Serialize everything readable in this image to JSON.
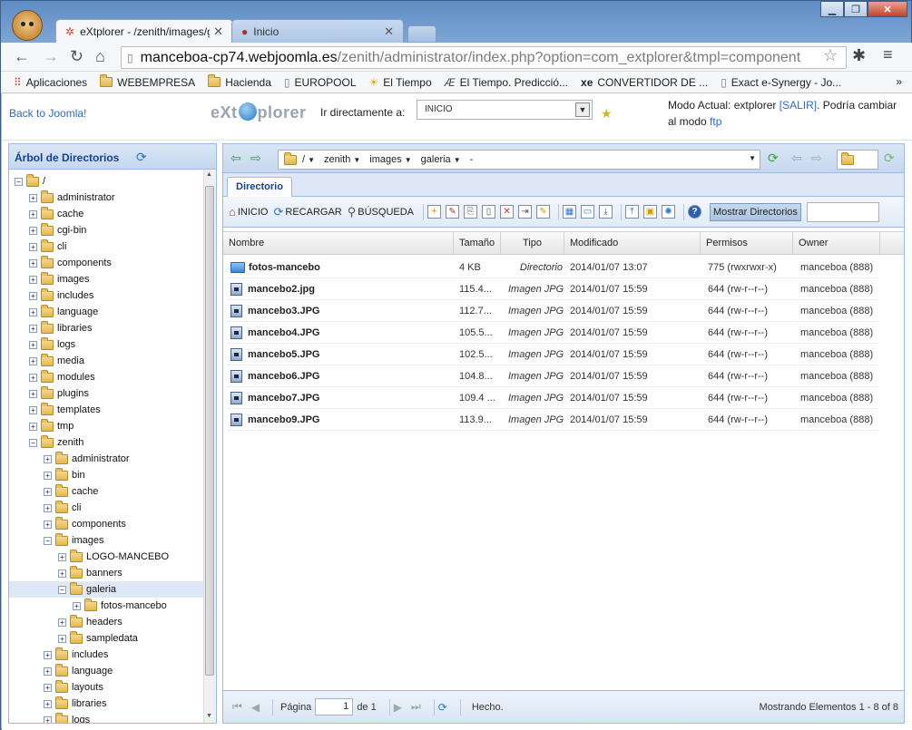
{
  "browser": {
    "tabs": [
      {
        "title": "eXtplorer - /zenith/images/galeria",
        "icon": "joomla-icon"
      },
      {
        "title": "Inicio",
        "icon": "drop-icon"
      }
    ],
    "url_domain": "manceboa-cp74.webjoomla.es",
    "url_path": "/zenith/administrator/index.php?option=com_extplorer&tmpl=component",
    "bookmarks": [
      "Aplicaciones",
      "WEBEMPRESA",
      "Hacienda",
      "EUROPOOL",
      "El Tiempo",
      "El Tiempo. Predicció...",
      "CONVERTIDOR DE ...",
      "Exact e-Synergy - Jo..."
    ]
  },
  "header": {
    "back_link": "Back to Joomla!",
    "logo_a": "eXt",
    "logo_b": "plorer",
    "goto_label": "Ir directamente a:",
    "goto_value": "INICIO",
    "mode_prefix": "Modo Actual: extplorer ",
    "mode_exit": "[SALIR]",
    "mode_mid": ". Podría cambiar al modo ",
    "mode_ftp": "ftp"
  },
  "left_panel": {
    "title": "Árbol de Directorios",
    "tree": [
      {
        "label": "/",
        "depth": 0,
        "open": true
      },
      {
        "label": "administrator",
        "depth": 1
      },
      {
        "label": "cache",
        "depth": 1
      },
      {
        "label": "cgi-bin",
        "depth": 1
      },
      {
        "label": "cli",
        "depth": 1
      },
      {
        "label": "components",
        "depth": 1
      },
      {
        "label": "images",
        "depth": 1
      },
      {
        "label": "includes",
        "depth": 1
      },
      {
        "label": "language",
        "depth": 1
      },
      {
        "label": "libraries",
        "depth": 1
      },
      {
        "label": "logs",
        "depth": 1
      },
      {
        "label": "media",
        "depth": 1
      },
      {
        "label": "modules",
        "depth": 1
      },
      {
        "label": "plugins",
        "depth": 1
      },
      {
        "label": "templates",
        "depth": 1
      },
      {
        "label": "tmp",
        "depth": 1
      },
      {
        "label": "zenith",
        "depth": 1,
        "open": true
      },
      {
        "label": "administrator",
        "depth": 2
      },
      {
        "label": "bin",
        "depth": 2
      },
      {
        "label": "cache",
        "depth": 2
      },
      {
        "label": "cli",
        "depth": 2
      },
      {
        "label": "components",
        "depth": 2
      },
      {
        "label": "images",
        "depth": 2,
        "open": true
      },
      {
        "label": "LOGO-MANCEBO",
        "depth": 3
      },
      {
        "label": "banners",
        "depth": 3
      },
      {
        "label": "galeria",
        "depth": 3,
        "open": true,
        "selected": true
      },
      {
        "label": "fotos-mancebo",
        "depth": 4
      },
      {
        "label": "headers",
        "depth": 3
      },
      {
        "label": "sampledata",
        "depth": 3
      },
      {
        "label": "includes",
        "depth": 2
      },
      {
        "label": "language",
        "depth": 2
      },
      {
        "label": "layouts",
        "depth": 2
      },
      {
        "label": "libraries",
        "depth": 2
      },
      {
        "label": "logs",
        "depth": 2
      }
    ]
  },
  "path_bar": {
    "crumbs": [
      "/",
      "zenith",
      "images",
      "galeria",
      "-"
    ]
  },
  "tab_label": "Directorio",
  "actions": {
    "home": "INICIO",
    "reload": "RECARGAR",
    "search": "BÚSQUEDA",
    "show_dirs": "Mostrar Directorios"
  },
  "grid": {
    "columns": [
      "Nombre",
      "Tamaño",
      "Tipo",
      "Modificado",
      "Permisos",
      "Owner"
    ],
    "rows": [
      {
        "name": "fotos-mancebo",
        "size": "4 KB",
        "type": "Directorio",
        "modified": "2014/01/07 13:07",
        "perms": "775 (rwxrwxr-x)",
        "owner": "manceboa (888)",
        "is_dir": true
      },
      {
        "name": "mancebo2.jpg",
        "size": "115.4...",
        "type": "Imagen JPG",
        "modified": "2014/01/07 15:59",
        "perms": "644 (rw-r--r--)",
        "owner": "manceboa (888)"
      },
      {
        "name": "mancebo3.JPG",
        "size": "112.7...",
        "type": "Imagen JPG",
        "modified": "2014/01/07 15:59",
        "perms": "644 (rw-r--r--)",
        "owner": "manceboa (888)"
      },
      {
        "name": "mancebo4.JPG",
        "size": "105.5...",
        "type": "Imagen JPG",
        "modified": "2014/01/07 15:59",
        "perms": "644 (rw-r--r--)",
        "owner": "manceboa (888)"
      },
      {
        "name": "mancebo5.JPG",
        "size": "102.5...",
        "type": "Imagen JPG",
        "modified": "2014/01/07 15:59",
        "perms": "644 (rw-r--r--)",
        "owner": "manceboa (888)"
      },
      {
        "name": "mancebo6.JPG",
        "size": "104.8...",
        "type": "Imagen JPG",
        "modified": "2014/01/07 15:59",
        "perms": "644 (rw-r--r--)",
        "owner": "manceboa (888)"
      },
      {
        "name": "mancebo7.JPG",
        "size": "109.4 ...",
        "type": "Imagen JPG",
        "modified": "2014/01/07 15:59",
        "perms": "644 (rw-r--r--)",
        "owner": "manceboa (888)"
      },
      {
        "name": "mancebo9.JPG",
        "size": "113.9...",
        "type": "Imagen JPG",
        "modified": "2014/01/07 15:59",
        "perms": "644 (rw-r--r--)",
        "owner": "manceboa (888)"
      }
    ]
  },
  "pager": {
    "page_label": "Página",
    "page_value": "1",
    "of_label": "de 1",
    "status": "Hecho.",
    "info": "Mostrando Elementos 1 - 8 of 8"
  }
}
